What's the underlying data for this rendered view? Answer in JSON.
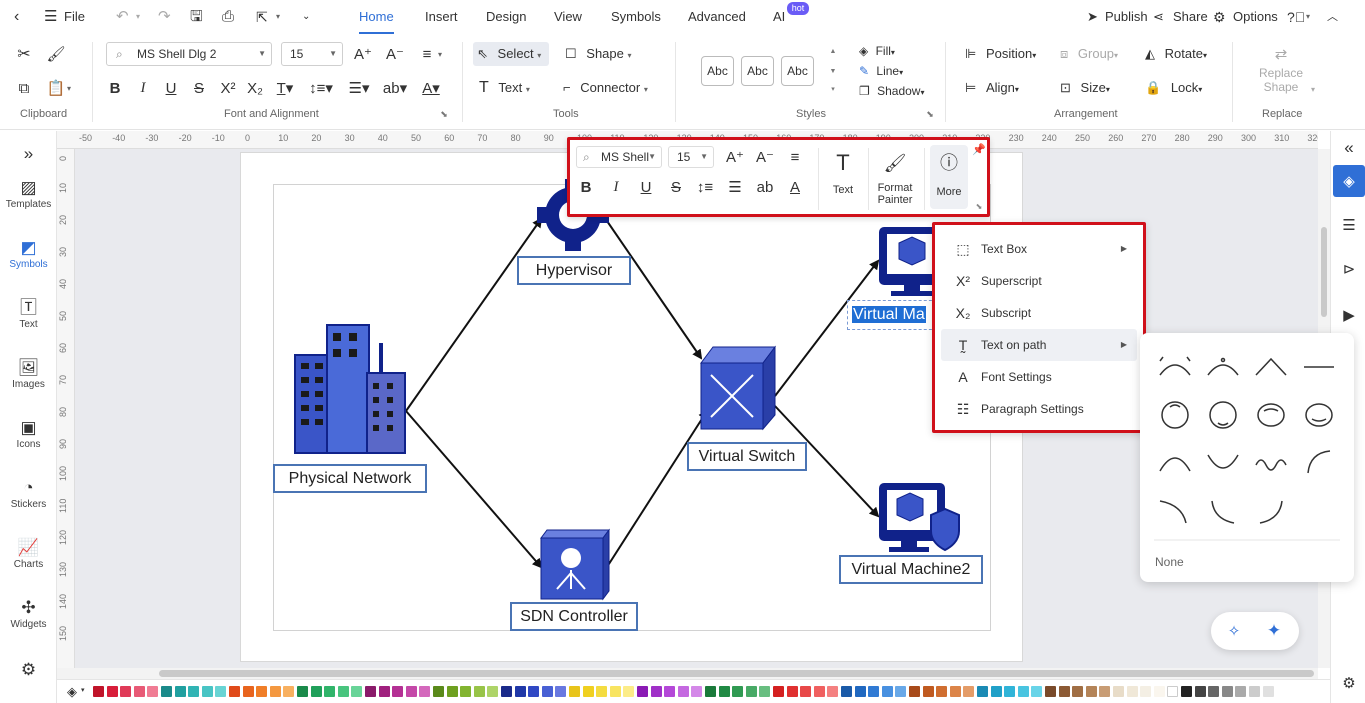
{
  "topbar": {
    "file_label": "File",
    "tabs": [
      "Home",
      "Insert",
      "Design",
      "View",
      "Symbols",
      "Advanced",
      "AI"
    ],
    "active_tab": "Home",
    "hot_badge": "hot",
    "publish_label": "Publish",
    "share_label": "Share",
    "options_label": "Options"
  },
  "ribbon": {
    "groups": {
      "clipboard": "Clipboard",
      "font_alignment": "Font and Alignment",
      "tools": "Tools",
      "styles": "Styles",
      "arrangement": "Arrangement",
      "replace": "Replace"
    },
    "font_name": "MS Shell Dlg 2",
    "font_size": "15",
    "select_label": "Select",
    "shape_label": "Shape",
    "text_label": "Text",
    "connector_label": "Connector",
    "style_swatches": [
      "Abc",
      "Abc",
      "Abc"
    ],
    "fill_label": "Fill",
    "line_label": "Line",
    "shadow_label": "Shadow",
    "position_label": "Position",
    "group_label": "Group",
    "rotate_label": "Rotate",
    "align_label": "Align",
    "size_label": "Size",
    "lock_label": "Lock",
    "replace_shape_line1": "Replace",
    "replace_shape_line2": "Shape"
  },
  "sidebar": {
    "items": [
      {
        "label": "Templates",
        "icon": "templates-icon"
      },
      {
        "label": "Symbols",
        "icon": "symbols-icon"
      },
      {
        "label": "Text",
        "icon": "text-icon"
      },
      {
        "label": "Images",
        "icon": "images-icon"
      },
      {
        "label": "Icons",
        "icon": "icons-icon"
      },
      {
        "label": "Stickers",
        "icon": "stickers-icon"
      },
      {
        "label": "Charts",
        "icon": "charts-icon"
      },
      {
        "label": "Widgets",
        "icon": "widgets-icon"
      }
    ],
    "active": "Symbols"
  },
  "rulers": {
    "horizontal": [
      "-50",
      "-40",
      "-30",
      "-20",
      "-10",
      "0",
      "10",
      "20",
      "30",
      "40",
      "50",
      "60",
      "70",
      "80",
      "90",
      "100",
      "110",
      "120",
      "130",
      "140",
      "150",
      "160",
      "170",
      "180",
      "190",
      "200",
      "210",
      "220",
      "230",
      "240",
      "250",
      "260",
      "270",
      "280",
      "290",
      "300",
      "310",
      "320",
      "330"
    ],
    "vertical": [
      "0",
      "10",
      "20",
      "30",
      "40",
      "50",
      "60",
      "70",
      "80",
      "90",
      "100",
      "110",
      "120",
      "130",
      "140",
      "150"
    ]
  },
  "diagram": {
    "nodes": {
      "physical": "Physical Network",
      "hypervisor": "Hypervisor",
      "vswitch": "Virtual Switch",
      "sdn": "SDN Controller",
      "vm1": "Virtual Ma",
      "vm2": "Virtual Machine2"
    }
  },
  "floatbar": {
    "font_name": "MS Shell",
    "font_size": "15",
    "text_label": "Text",
    "format_painter_line1": "Format",
    "format_painter_line2": "Painter",
    "more_label": "More"
  },
  "context_menu": {
    "items": [
      {
        "label": "Text Box",
        "has_submenu": true
      },
      {
        "label": "Superscript",
        "has_submenu": false
      },
      {
        "label": "Subscript",
        "has_submenu": false
      },
      {
        "label": "Text on path",
        "has_submenu": true
      },
      {
        "label": "Font Settings",
        "has_submenu": false
      },
      {
        "label": "Paragraph Settings",
        "has_submenu": false
      }
    ],
    "highlighted": "Text on path"
  },
  "text_on_path": {
    "none_label": "None"
  },
  "colors": {
    "accent": "#2f6fd6",
    "highlight_frame": "#d0101a",
    "node_fill": "#3a55c8",
    "node_dark": "#10228a",
    "palette": [
      "#c0142a",
      "#d81e3a",
      "#e03a58",
      "#e85a76",
      "#f07c94",
      "#1a8a8a",
      "#20a0a0",
      "#30b4b4",
      "#48c4c4",
      "#68d4d4",
      "#e04a1a",
      "#e8641e",
      "#f07e28",
      "#f49840",
      "#f8b060",
      "#1a8a4a",
      "#20a05a",
      "#30b46a",
      "#48c47e",
      "#68d498",
      "#8a1a6a",
      "#a0207e",
      "#b43094",
      "#c448a8",
      "#d468bc",
      "#5a8a1a",
      "#6ea020",
      "#82b430",
      "#98c448",
      "#aed468",
      "#1a2a8a",
      "#2038a8",
      "#3048c4",
      "#4860d4",
      "#6878e0",
      "#e8c41a",
      "#f0d020",
      "#f4dc40",
      "#f8e460",
      "#fcec88",
      "#8a1ab4",
      "#a030c8",
      "#b448d8",
      "#c468e0",
      "#d488e8",
      "#1a7a3a",
      "#208a44",
      "#309a52",
      "#48aa66",
      "#68be80",
      "#d42020",
      "#e03030",
      "#e84848",
      "#f06060",
      "#f48080",
      "#1a5aa8",
      "#2068c0",
      "#307ad4",
      "#4890e0",
      "#68a8e8",
      "#a84a1a",
      "#c05a20",
      "#d06e30",
      "#dc8448",
      "#e49c68",
      "#1a8ab4",
      "#20a0c8",
      "#30b4d8",
      "#48c4e0",
      "#68d4e8",
      "#7a4a2a",
      "#8c5a34",
      "#a06e44",
      "#b48458",
      "#c89c74",
      "#e8dcc8",
      "#f0e8d8",
      "#f4efe4",
      "#faf6ee",
      "#ffffff",
      "#222222",
      "#444444",
      "#666666",
      "#888888",
      "#aaaaaa",
      "#cccccc",
      "#e0e0e0"
    ]
  }
}
